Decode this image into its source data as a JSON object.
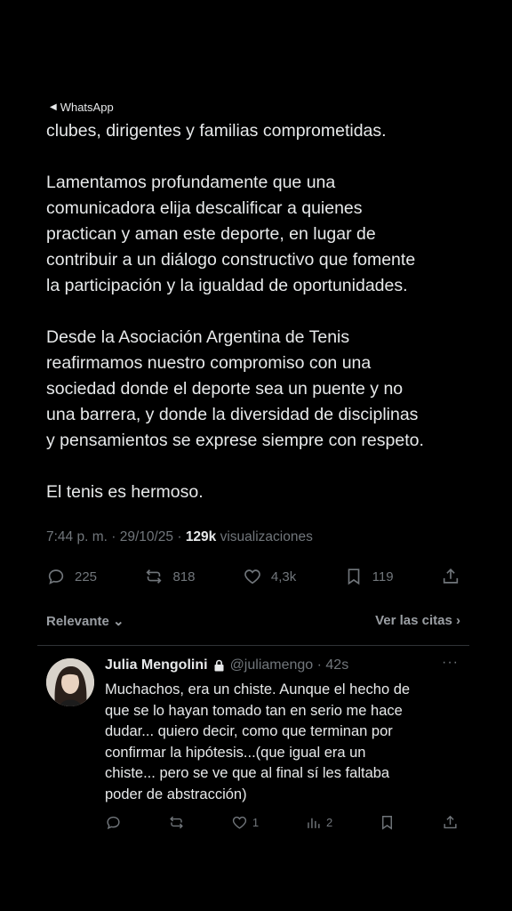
{
  "back_link": {
    "label": "WhatsApp"
  },
  "tweet": {
    "paragraphs": [
      "clubes, dirigentes y familias comprometidas.",
      "Lamentamos profundamente que una\ncomunicadora elija descalificar a quienes\npractican y aman este deporte, en lugar de\ncontribuir a un diálogo constructivo que fomente\nla participación y la igualdad de oportunidades.",
      "Desde la Asociación Argentina de Tenis\nreafirmamos nuestro compromiso con una\nsociedad donde el deporte sea un puente y no\nuna barrera, y donde la diversidad de disciplinas\ny pensamientos se exprese siempre con respeto.",
      "El tenis es hermoso."
    ],
    "meta": {
      "time_date": "7:44 p. m. · 29/10/25 · ",
      "views_count": "129k",
      "views_label": " visualizaciones"
    },
    "actions": {
      "replies": "225",
      "reposts": "818",
      "likes": "4,3k",
      "bookmarks": "119"
    }
  },
  "filter": {
    "sort_label": "Relevante",
    "quotes_label": "Ver las citas"
  },
  "reply": {
    "name": "Julia Mengolini",
    "handle_time": "@juliamengo · 42s",
    "text": "Muchachos, era un chiste. Aunque el hecho de\nque se lo hayan tomado tan en serio me hace\ndudar... quiero decir, como que terminan por\nconfirmar la hipótesis...(que igual era un\nchiste... pero se ve que al final sí les faltaba\npoder de abstracción)",
    "actions": {
      "likes": "1",
      "views": "2"
    }
  }
}
